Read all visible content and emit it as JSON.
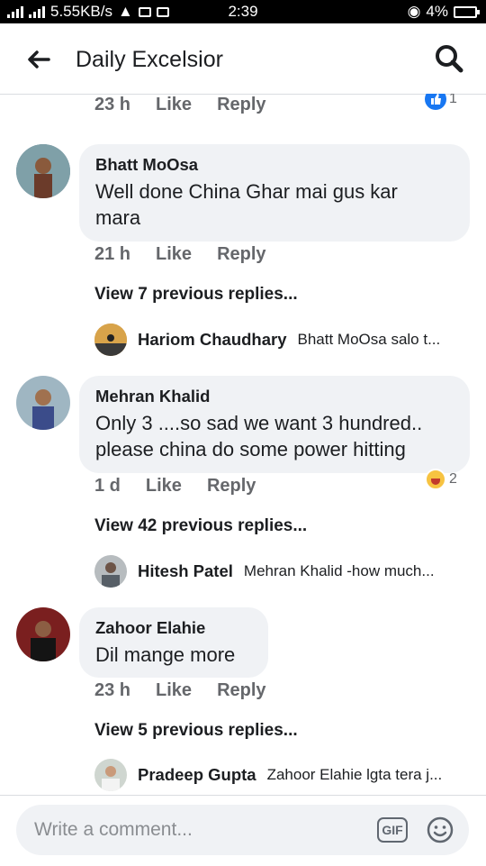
{
  "status_bar": {
    "network_speed": "5.55KB/s",
    "time": "2:39",
    "battery": "4%"
  },
  "header": {
    "title": "Daily Excelsior",
    "back_icon": "back-arrow-icon",
    "search_icon": "search-icon"
  },
  "top_comment": {
    "time": "23 h",
    "like": "Like",
    "reply": "Reply",
    "reaction_count": "1"
  },
  "comments": [
    {
      "author": "Bhatt MoOsa",
      "text_line1": "Well done China Ghar mai gus kar",
      "text_line2": "mara",
      "time": "21 h",
      "like": "Like",
      "reply": "Reply",
      "view_previous": "View 7 previous replies...",
      "latest_reply_author": "Hariom Chaudhary",
      "latest_reply_text": "Bhatt MoOsa salo t..."
    },
    {
      "author": "Mehran Khalid",
      "text_line1": "Only 3 ....so sad we want 3 hundred..",
      "text_line2": "please china do some power hitting",
      "time": "1 d",
      "like": "Like",
      "reply": "Reply",
      "reaction_count": "2",
      "view_previous": "View 42 previous replies...",
      "latest_reply_author": "Hitesh Patel",
      "latest_reply_text": "Mehran Khalid -how much..."
    },
    {
      "author": "Zahoor Elahie",
      "text_line1": "Dil mange more",
      "time": "23 h",
      "like": "Like",
      "reply": "Reply",
      "view_previous": "View 5 previous replies...",
      "latest_reply_author": "Pradeep Gupta",
      "latest_reply_text": "Zahoor Elahie lgta tera j..."
    }
  ],
  "composer": {
    "placeholder": "Write a comment...",
    "gif_label": "GIF"
  },
  "colors": {
    "bubble": "#f0f2f5",
    "meta_text": "#65676b",
    "accent": "#1877f2"
  }
}
